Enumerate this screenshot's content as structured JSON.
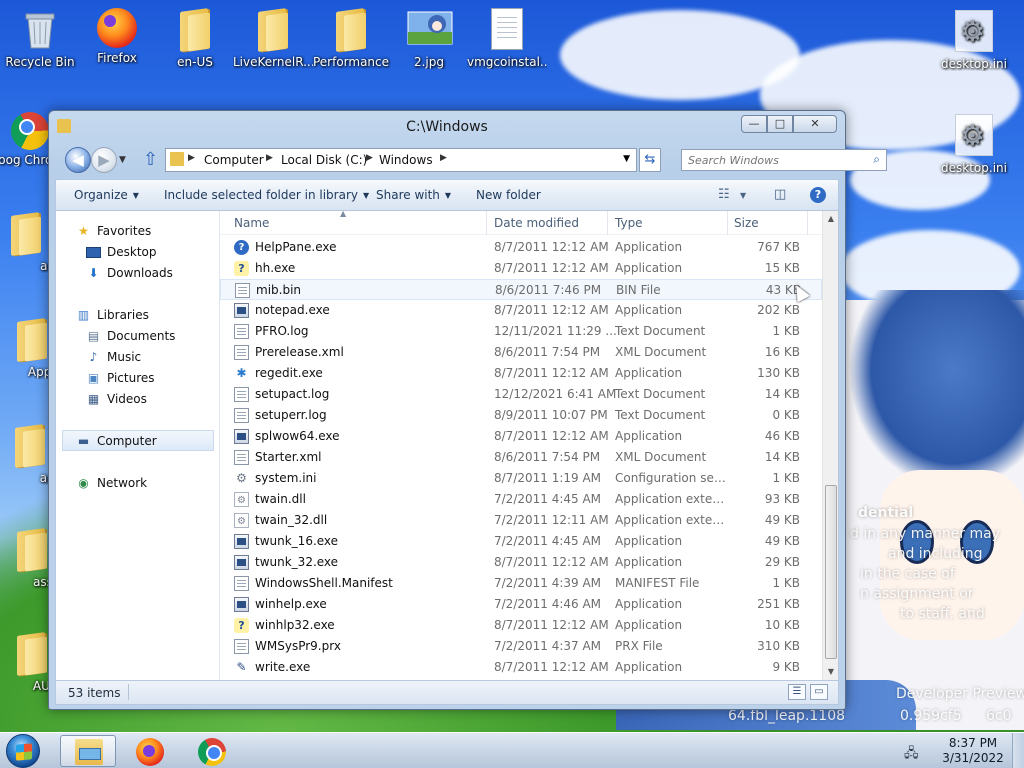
{
  "desktop": {
    "icons_left": [
      {
        "label": "Recycle Bin",
        "icon": "recycle-bin-icon"
      },
      {
        "label": "Firefox",
        "icon": "firefox-icon"
      },
      {
        "label": "en-US",
        "icon": "folder-icon"
      },
      {
        "label": "LiveKernelR...",
        "icon": "folder-icon"
      },
      {
        "label": "Performance",
        "icon": "folder-icon"
      },
      {
        "label": "2.jpg",
        "icon": "image-icon"
      },
      {
        "label": "vmgcoinstal...",
        "icon": "document-icon"
      }
    ],
    "icons_column": [
      {
        "label": "Goog Chron",
        "icon": "chrome-icon"
      },
      {
        "label": "addi",
        "icon": "folder-icon"
      },
      {
        "label": "AppCor",
        "icon": "folder-icon"
      },
      {
        "label": "appp",
        "icon": "folder-icon"
      },
      {
        "label": "assem",
        "icon": "folder-icon"
      },
      {
        "label": "AUInst",
        "icon": "folder-icon"
      }
    ],
    "icons_right": [
      {
        "label": "desktop.ini",
        "icon": "settings-file-icon"
      },
      {
        "label": "desktop.ini",
        "icon": "settings-file-icon"
      }
    ],
    "watermark": {
      "title": "dential",
      "lines": [
        "d in any manner may",
        "and including",
        "in the case of",
        "n assignment or",
        "to staff, and",
        "Developer Preview",
        "64.fbl_leap.1108",
        "0.959cf5",
        "6c0"
      ]
    }
  },
  "window": {
    "title": "C:\\Windows",
    "caption_buttons": {
      "minimize": "—",
      "maximize": "□",
      "close": "✕"
    },
    "address": {
      "crumbs": [
        "Computer",
        "Local Disk (C:)",
        "Windows"
      ]
    },
    "search": {
      "placeholder": "Search Windows"
    },
    "toolbar": {
      "organize": "Organize",
      "include": "Include selected folder in library",
      "share": "Share with",
      "new_folder": "New folder"
    },
    "nav": {
      "favorites": "Favorites",
      "desktop": "Desktop",
      "downloads": "Downloads",
      "libraries": "Libraries",
      "documents": "Documents",
      "music": "Music",
      "pictures": "Pictures",
      "videos": "Videos",
      "computer": "Computer",
      "network": "Network"
    },
    "columns": {
      "name": "Name",
      "date": "Date modified",
      "type": "Type",
      "size": "Size"
    },
    "files": [
      {
        "name": "HelpPane.exe",
        "date": "8/7/2011 12:12 AM",
        "type": "Application",
        "size": "767 KB",
        "icon": "help-icon"
      },
      {
        "name": "hh.exe",
        "date": "8/7/2011 12:12 AM",
        "type": "Application",
        "size": "15 KB",
        "icon": "help-question-icon"
      },
      {
        "name": "mib.bin",
        "date": "8/6/2011 7:46 PM",
        "type": "BIN File",
        "size": "43 KB",
        "icon": "blank-file-icon"
      },
      {
        "name": "notepad.exe",
        "date": "8/7/2011 12:12 AM",
        "type": "Application",
        "size": "202 KB",
        "icon": "notepad-icon"
      },
      {
        "name": "PFRO.log",
        "date": "12/11/2021 11:29 ...",
        "type": "Text Document",
        "size": "1 KB",
        "icon": "text-file-icon"
      },
      {
        "name": "Prerelease.xml",
        "date": "8/6/2011 7:54 PM",
        "type": "XML Document",
        "size": "16 KB",
        "icon": "xml-file-icon"
      },
      {
        "name": "regedit.exe",
        "date": "8/7/2011 12:12 AM",
        "type": "Application",
        "size": "130 KB",
        "icon": "regedit-icon"
      },
      {
        "name": "setupact.log",
        "date": "12/12/2021 6:41 AM",
        "type": "Text Document",
        "size": "14 KB",
        "icon": "text-file-icon"
      },
      {
        "name": "setuperr.log",
        "date": "8/9/2011 10:07 PM",
        "type": "Text Document",
        "size": "0 KB",
        "icon": "text-file-icon"
      },
      {
        "name": "splwow64.exe",
        "date": "8/7/2011 12:12 AM",
        "type": "Application",
        "size": "46 KB",
        "icon": "exe-icon"
      },
      {
        "name": "Starter.xml",
        "date": "8/6/2011 7:54 PM",
        "type": "XML Document",
        "size": "14 KB",
        "icon": "xml-file-icon"
      },
      {
        "name": "system.ini",
        "date": "8/7/2011 1:19 AM",
        "type": "Configuration sett...",
        "size": "1 KB",
        "icon": "config-file-icon"
      },
      {
        "name": "twain.dll",
        "date": "7/2/2011 4:45 AM",
        "type": "Application extens...",
        "size": "93 KB",
        "icon": "dll-icon"
      },
      {
        "name": "twain_32.dll",
        "date": "7/2/2011 12:11 AM",
        "type": "Application extens...",
        "size": "49 KB",
        "icon": "dll-icon"
      },
      {
        "name": "twunk_16.exe",
        "date": "7/2/2011 4:45 AM",
        "type": "Application",
        "size": "49 KB",
        "icon": "exe-icon"
      },
      {
        "name": "twunk_32.exe",
        "date": "8/7/2011 12:12 AM",
        "type": "Application",
        "size": "29 KB",
        "icon": "exe-icon"
      },
      {
        "name": "WindowsShell.Manifest",
        "date": "7/2/2011 4:39 AM",
        "type": "MANIFEST File",
        "size": "1 KB",
        "icon": "blank-file-icon"
      },
      {
        "name": "winhelp.exe",
        "date": "7/2/2011 4:46 AM",
        "type": "Application",
        "size": "251 KB",
        "icon": "exe-icon"
      },
      {
        "name": "winhlp32.exe",
        "date": "8/7/2011 12:12 AM",
        "type": "Application",
        "size": "10 KB",
        "icon": "help-question-icon"
      },
      {
        "name": "WMSysPr9.prx",
        "date": "7/2/2011 4:37 AM",
        "type": "PRX File",
        "size": "310 KB",
        "icon": "blank-file-icon"
      },
      {
        "name": "write.exe",
        "date": "8/7/2011 12:12 AM",
        "type": "Application",
        "size": "9 KB",
        "icon": "write-icon"
      }
    ],
    "status": {
      "count": "53 items"
    }
  },
  "taskbar": {
    "clock_time": "8:37 PM",
    "clock_date": "3/31/2022",
    "apps": [
      "Windows Explorer",
      "Firefox",
      "Google Chrome"
    ]
  },
  "colors": {
    "accent": "#2f6bc4",
    "selection": "#dde9f8",
    "titlebar": "#c5d9ef"
  }
}
